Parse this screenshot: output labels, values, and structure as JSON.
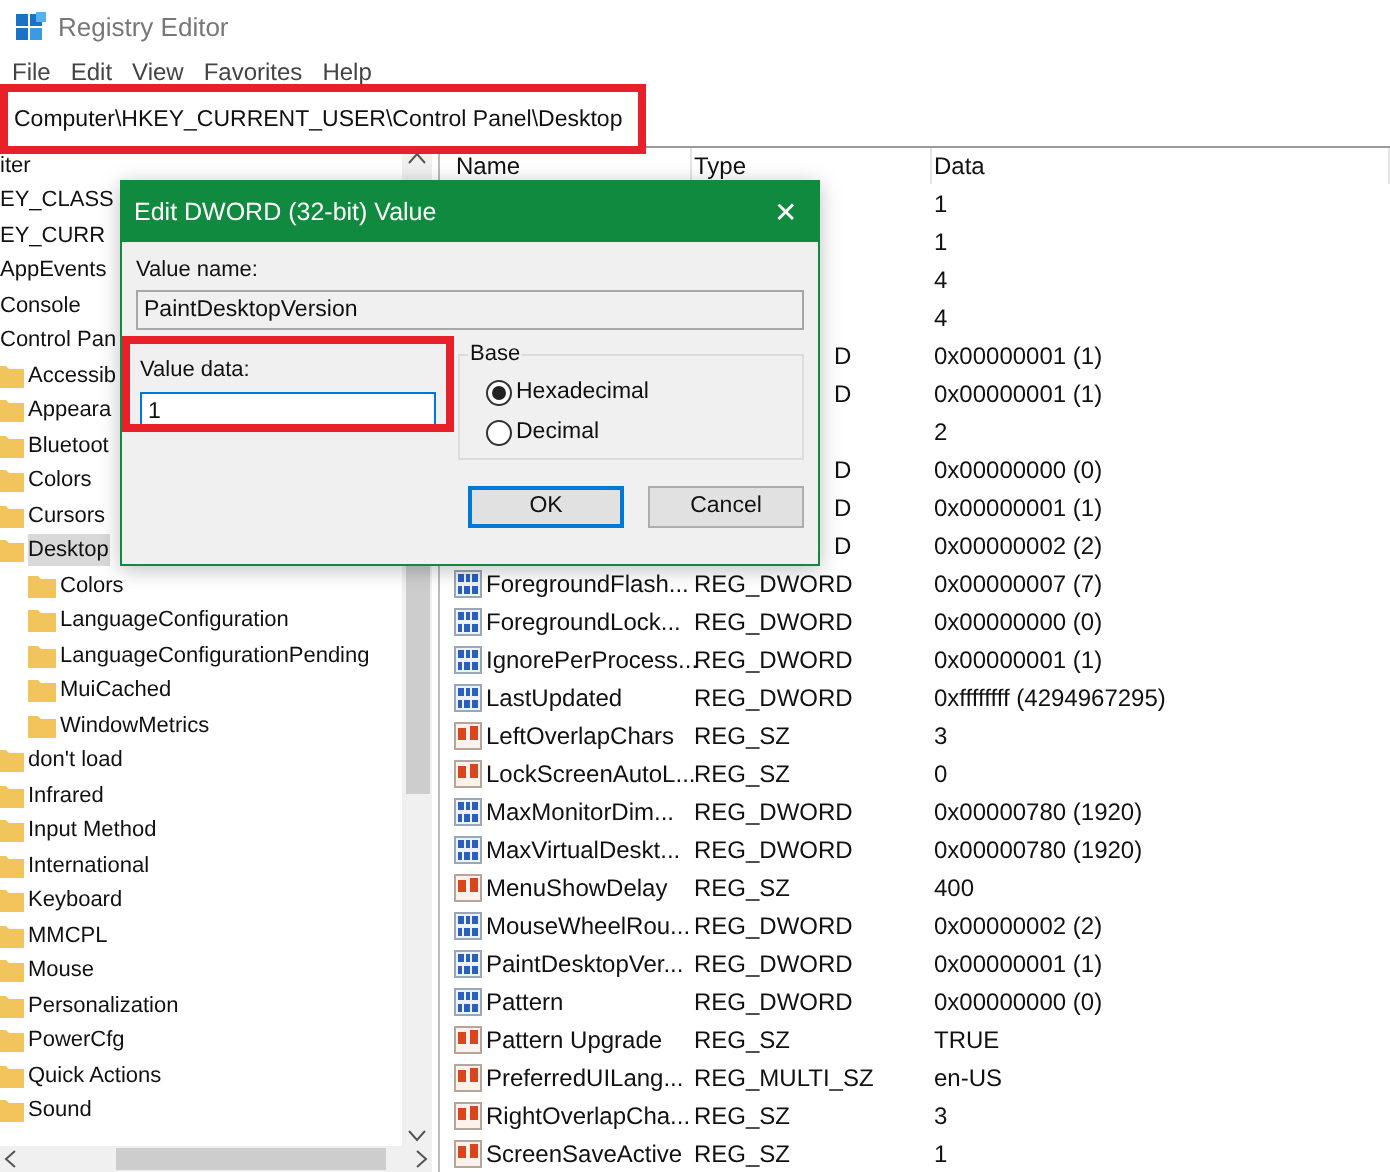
{
  "window": {
    "title": "Registry Editor"
  },
  "menu": [
    "File",
    "Edit",
    "View",
    "Favorites",
    "Help"
  ],
  "address_bar": {
    "value": "Computer\\HKEY_CURRENT_USER\\Control Panel\\Desktop",
    "highlighted": true
  },
  "tree": {
    "items": [
      {
        "label": "iter",
        "selected": false,
        "children": [
          {
            "label": "EY_CLASS",
            "selected": false
          },
          {
            "label": "EY_CURR",
            "selected": false,
            "children": [
              {
                "label": "AppEvents",
                "selected": false
              },
              {
                "label": "Console",
                "selected": false
              },
              {
                "label": "Control Pan",
                "selected": false,
                "children": [
                  {
                    "label": "Accessib",
                    "selected": false
                  },
                  {
                    "label": "Appeara",
                    "selected": false
                  },
                  {
                    "label": "Bluetoot",
                    "selected": false
                  },
                  {
                    "label": "Colors",
                    "selected": false
                  },
                  {
                    "label": "Cursors",
                    "selected": false
                  },
                  {
                    "label": "Desktop",
                    "selected": true,
                    "children": [
                      {
                        "label": "Colors",
                        "selected": false
                      },
                      {
                        "label": "LanguageConfiguration",
                        "selected": false
                      },
                      {
                        "label": "LanguageConfigurationPending",
                        "selected": false
                      },
                      {
                        "label": "MuiCached",
                        "selected": false
                      },
                      {
                        "label": "WindowMetrics",
                        "selected": false
                      }
                    ]
                  },
                  {
                    "label": "don't load",
                    "selected": false
                  },
                  {
                    "label": "Infrared",
                    "selected": false
                  },
                  {
                    "label": "Input Method",
                    "selected": false
                  },
                  {
                    "label": "International",
                    "selected": false
                  },
                  {
                    "label": "Keyboard",
                    "selected": false
                  },
                  {
                    "label": "MMCPL",
                    "selected": false
                  },
                  {
                    "label": "Mouse",
                    "selected": false
                  },
                  {
                    "label": "Personalization",
                    "selected": false
                  },
                  {
                    "label": "PowerCfg",
                    "selected": false
                  },
                  {
                    "label": "Quick Actions",
                    "selected": false
                  },
                  {
                    "label": "Sound",
                    "selected": false
                  }
                ]
              }
            ]
          }
        ]
      }
    ]
  },
  "list": {
    "columns": [
      "Name",
      "Type",
      "Data"
    ],
    "rows": [
      {
        "data": "1"
      },
      {
        "data": "1"
      },
      {
        "data": "4"
      },
      {
        "data": "4"
      },
      {
        "type": "D",
        "data": "0x00000001 (1)"
      },
      {
        "type": "D",
        "data": "0x00000001 (1)"
      },
      {
        "data": "2"
      },
      {
        "type": "D",
        "data": "0x00000000 (0)"
      },
      {
        "type": "D",
        "data": "0x00000001 (1)"
      },
      {
        "type": "D",
        "data": "0x00000002 (2)"
      },
      {
        "kind": "dword",
        "name": "ForegroundFlash...",
        "type": "REG_DWORD",
        "data": "0x00000007 (7)"
      },
      {
        "kind": "dword",
        "name": "ForegroundLock...",
        "type": "REG_DWORD",
        "data": "0x00000000 (0)"
      },
      {
        "kind": "dword",
        "name": "IgnorePerProcess...",
        "type": "REG_DWORD",
        "data": "0x00000001 (1)"
      },
      {
        "kind": "dword",
        "name": "LastUpdated",
        "type": "REG_DWORD",
        "data": "0xffffffff (4294967295)"
      },
      {
        "kind": "string",
        "name": "LeftOverlapChars",
        "type": "REG_SZ",
        "data": "3"
      },
      {
        "kind": "string",
        "name": "LockScreenAutoL...",
        "type": "REG_SZ",
        "data": "0"
      },
      {
        "kind": "dword",
        "name": "MaxMonitorDim...",
        "type": "REG_DWORD",
        "data": "0x00000780 (1920)"
      },
      {
        "kind": "dword",
        "name": "MaxVirtualDeskt...",
        "type": "REG_DWORD",
        "data": "0x00000780 (1920)"
      },
      {
        "kind": "string",
        "name": "MenuShowDelay",
        "type": "REG_SZ",
        "data": "400"
      },
      {
        "kind": "dword",
        "name": "MouseWheelRou...",
        "type": "REG_DWORD",
        "data": "0x00000002 (2)"
      },
      {
        "kind": "dword",
        "name": "PaintDesktopVer...",
        "type": "REG_DWORD",
        "data": "0x00000001 (1)"
      },
      {
        "kind": "dword",
        "name": "Pattern",
        "type": "REG_DWORD",
        "data": "0x00000000 (0)"
      },
      {
        "kind": "string",
        "name": "Pattern Upgrade",
        "type": "REG_SZ",
        "data": "TRUE"
      },
      {
        "kind": "string",
        "name": "PreferredUILang...",
        "type": "REG_MULTI_SZ",
        "data": "en-US"
      },
      {
        "kind": "string",
        "name": "RightOverlapCha...",
        "type": "REG_SZ",
        "data": "3"
      },
      {
        "kind": "string",
        "name": "ScreenSaveActive",
        "type": "REG_SZ",
        "data": "1"
      }
    ]
  },
  "dialog": {
    "title": "Edit DWORD (32-bit) Value",
    "close": "✕",
    "value_name_label": "Value name:",
    "value_name": "PaintDesktopVersion",
    "value_data_label": "Value data:",
    "value_data": "1",
    "value_data_highlighted": true,
    "base_label": "Base",
    "base_options": [
      {
        "label": "Hexadecimal",
        "selected": true
      },
      {
        "label": "Decimal",
        "selected": false
      }
    ],
    "buttons": [
      {
        "label": "OK",
        "default": true
      },
      {
        "label": "Cancel",
        "default": false
      }
    ]
  }
}
